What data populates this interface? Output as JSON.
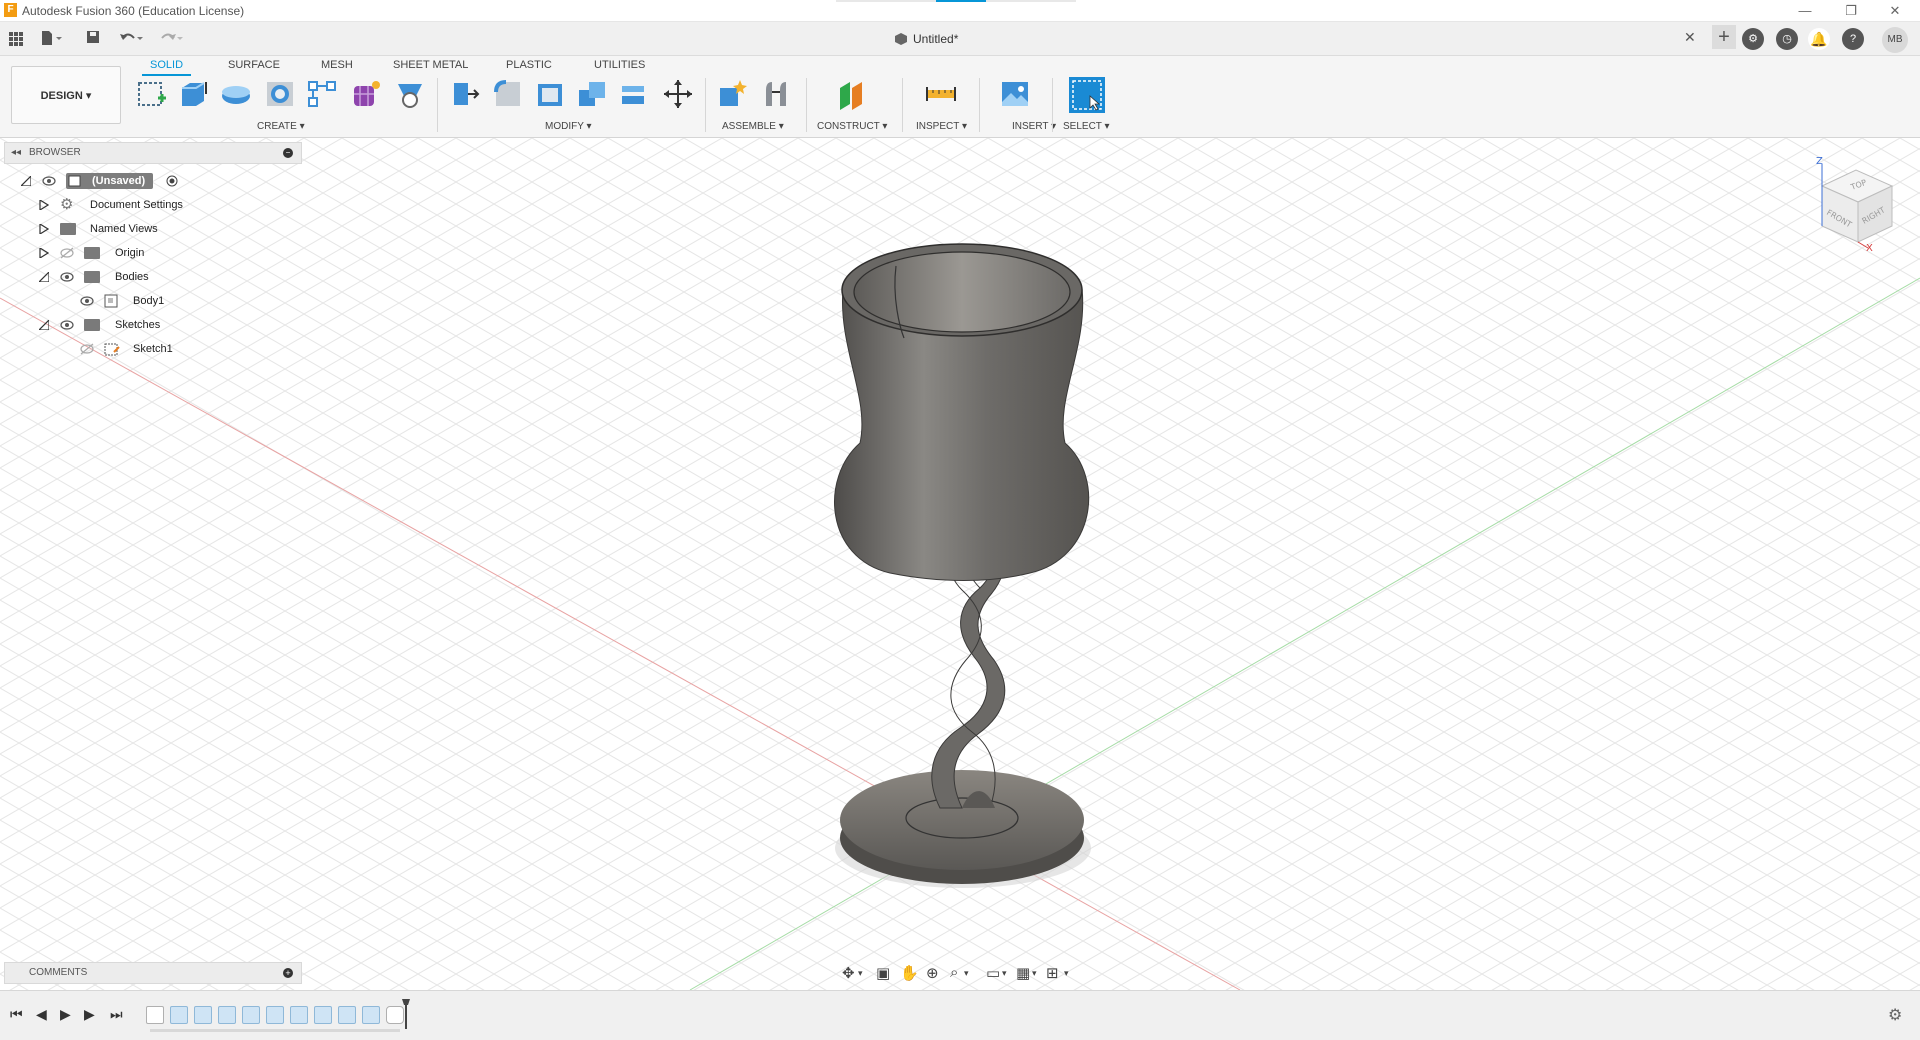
{
  "window": {
    "title": "Autodesk Fusion 360 (Education License)",
    "app_icon_letter": "F",
    "minimize": "—",
    "restore": "❐",
    "close": "✕"
  },
  "document": {
    "tab_title": "Untitled*",
    "close_glyph": "✕",
    "new_tab_glyph": "+"
  },
  "user": {
    "initials": "MB"
  },
  "toolbar": {
    "workspace": "DESIGN ▾",
    "tabs": [
      "SOLID",
      "SURFACE",
      "MESH",
      "SHEET METAL",
      "PLASTIC",
      "UTILITIES"
    ],
    "active_tab": "SOLID",
    "groups": [
      "CREATE ▾",
      "MODIFY ▾",
      "ASSEMBLE ▾",
      "CONSTRUCT ▾",
      "INSPECT ▾",
      "INSERT ▾",
      "SELECT ▾"
    ]
  },
  "browser": {
    "title": "BROWSER",
    "collapse_glyph": "◂◂",
    "items": [
      {
        "label": "(Unsaved)"
      },
      {
        "label": "Document Settings"
      },
      {
        "label": "Named Views"
      },
      {
        "label": "Origin"
      },
      {
        "label": "Bodies"
      },
      {
        "label": "Body1"
      },
      {
        "label": "Sketches"
      },
      {
        "label": "Sketch1"
      }
    ]
  },
  "comments": {
    "title": "COMMENTS"
  },
  "viewcube": {
    "top": "TOP",
    "front": "FRONT",
    "right": "RIGHT",
    "z_axis": "Z",
    "x_axis": "X"
  },
  "colors": {
    "accent": "#0696d7",
    "model": "#6e6c69",
    "grid_line": "#e3e3e3",
    "x_axis_line": "#e58a8a",
    "y_axis_line": "#8fd48f"
  }
}
